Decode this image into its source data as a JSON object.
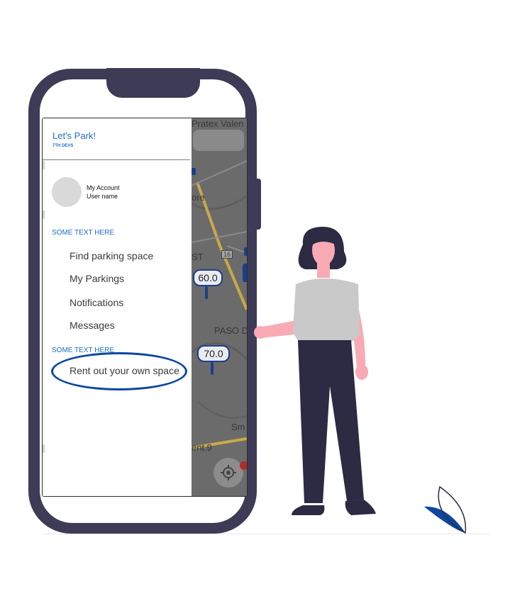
{
  "app": {
    "title": "Let's Park!",
    "subtitle": "7TH DEVS"
  },
  "account": {
    "label": "My Account",
    "username": "User name"
  },
  "sections": [
    {
      "title": "SOME TEXT HERE"
    },
    {
      "title": "SOME TEXT HERE"
    }
  ],
  "menu": [
    {
      "label": "Find parking space"
    },
    {
      "label": "My Parkings"
    },
    {
      "label": "Notifications"
    },
    {
      "label": "Messages"
    },
    {
      "label": "Rent out your own space"
    }
  ],
  "map": {
    "place_top": "Pratex Valen",
    "place_ore": "ore",
    "place_st": "ST",
    "road_number": "16",
    "place_paso": "PASO D",
    "place_sm": "Sm",
    "place_ent": "ent.9",
    "prices": [
      "60.0",
      "70.0"
    ]
  },
  "colors": {
    "phone_frame": "#3d3b56",
    "accent_blue": "#1d6fc9",
    "highlight_ring": "#0d47a1",
    "shirt": "#c9c9c9",
    "skin": "#f9aab4",
    "leaf": "#0d47a1"
  },
  "icons": [
    "locate-icon",
    "avatar-placeholder"
  ]
}
